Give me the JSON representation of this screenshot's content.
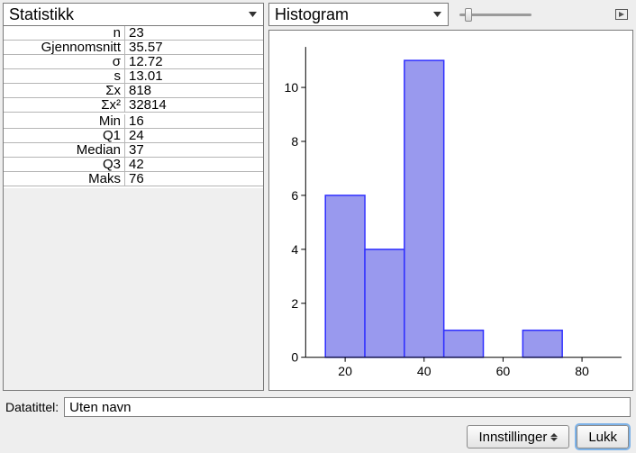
{
  "left": {
    "dropdown_label": "Statistikk",
    "stats_group1": [
      {
        "label": "n",
        "value": "23"
      },
      {
        "label": "Gjennomsnitt",
        "value": "35.57"
      },
      {
        "label": "σ",
        "value": "12.72"
      },
      {
        "label": "s",
        "value": "13.01"
      },
      {
        "label": "Σx",
        "value": "818"
      },
      {
        "label": "Σx²",
        "value": "32814"
      }
    ],
    "stats_group2": [
      {
        "label": "Min",
        "value": "16"
      },
      {
        "label": "Q1",
        "value": "24"
      },
      {
        "label": "Median",
        "value": "37"
      },
      {
        "label": "Q3",
        "value": "42"
      },
      {
        "label": "Maks",
        "value": "76"
      }
    ]
  },
  "right": {
    "dropdown_label": "Histogram"
  },
  "footer": {
    "title_label": "Datatittel:",
    "title_value": "Uten navn",
    "settings_label": "Innstillinger",
    "close_label": "Lukk"
  },
  "chart_data": {
    "type": "bar",
    "title": "",
    "xlabel": "",
    "ylabel": "",
    "x_ticks": [
      20,
      40,
      60,
      80
    ],
    "y_ticks": [
      0,
      2,
      4,
      6,
      8,
      10
    ],
    "xlim": [
      10,
      90
    ],
    "ylim": [
      0,
      11.5
    ],
    "bin_edges": [
      15,
      25,
      35,
      45,
      55,
      65,
      75
    ],
    "counts": [
      6,
      4,
      11,
      1,
      0,
      1
    ],
    "bar_fill": "#9999ee",
    "bar_stroke": "#3030ff"
  }
}
